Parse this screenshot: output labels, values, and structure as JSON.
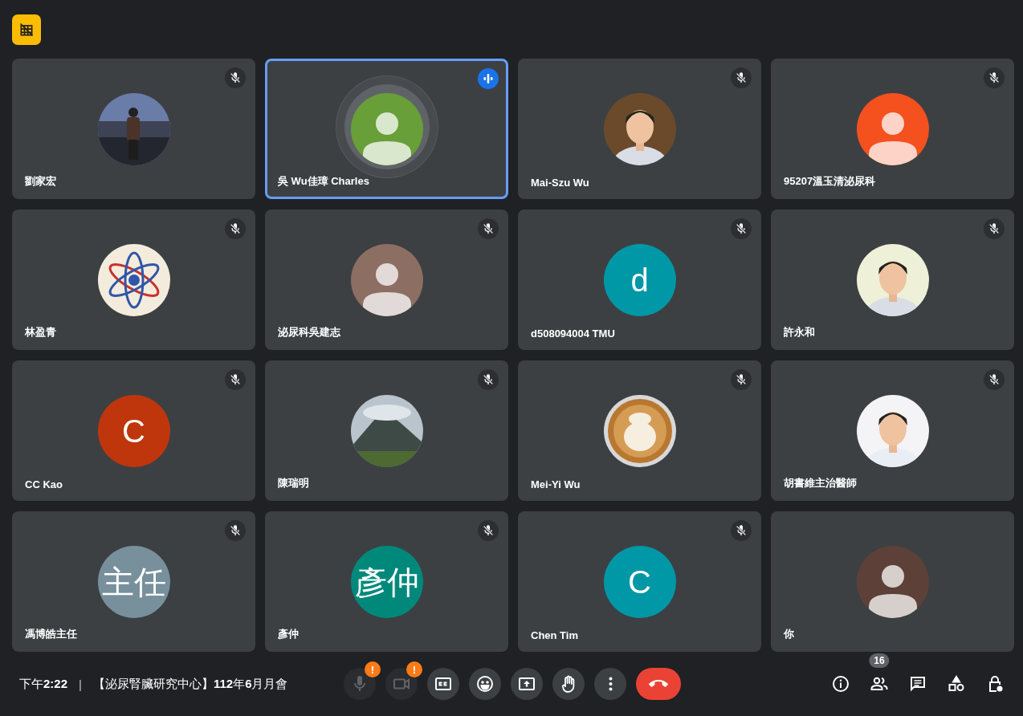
{
  "tiles": [
    {
      "name": "劉家宏",
      "muted": true,
      "speaking": false
    },
    {
      "name": "吳 Wu佳璋 Charles",
      "muted": false,
      "speaking": true,
      "avatar": {
        "kind": "default",
        "color": "#689f38"
      }
    },
    {
      "name": "Mai-Szu Wu",
      "muted": true,
      "speaking": false
    },
    {
      "name": "95207溫玉清泌尿科",
      "muted": true,
      "speaking": false,
      "avatar": {
        "kind": "default",
        "color": "#f4511e"
      }
    },
    {
      "name": "林盈青",
      "muted": true,
      "speaking": false
    },
    {
      "name": "泌尿科吳建志",
      "muted": true,
      "speaking": false,
      "avatar": {
        "kind": "default",
        "color": "#8d6e63"
      }
    },
    {
      "name": "d508094004 TMU",
      "muted": true,
      "speaking": false,
      "avatar": {
        "kind": "letter",
        "text": "d",
        "color": "#0097a7"
      }
    },
    {
      "name": "許永和",
      "muted": true,
      "speaking": false
    },
    {
      "name": "CC Kao",
      "muted": true,
      "speaking": false,
      "avatar": {
        "kind": "letter",
        "text": "C",
        "color": "#bf360c"
      }
    },
    {
      "name": "陳瑞明",
      "muted": true,
      "speaking": false
    },
    {
      "name": "Mei-Yi Wu",
      "muted": true,
      "speaking": false
    },
    {
      "name": "胡書維主治醫師",
      "muted": true,
      "speaking": false
    },
    {
      "name": "馮博皓主任",
      "muted": true,
      "speaking": false,
      "avatar": {
        "kind": "letter",
        "text": "主任",
        "color": "#78909c"
      }
    },
    {
      "name": "彥仲",
      "muted": true,
      "speaking": false,
      "avatar": {
        "kind": "letter",
        "text": "彥仲",
        "color": "#00897b"
      }
    },
    {
      "name": "Chen Tim",
      "muted": true,
      "speaking": false,
      "avatar": {
        "kind": "letter",
        "text": "C",
        "color": "#0097a7"
      }
    },
    {
      "name": "你",
      "muted": false,
      "speaking": false,
      "avatar": {
        "kind": "default",
        "color": "#5d4037"
      }
    }
  ],
  "bottom_bar": {
    "clock": "下午**2:22**",
    "separator": "|",
    "meeting_title": "【泌尿腎臟研究中心】**112**年**6**月月會",
    "controls": [
      {
        "kind": "mic",
        "disabled": true,
        "alert": "!"
      },
      {
        "kind": "camera",
        "disabled": true,
        "alert": "!"
      },
      {
        "kind": "captions",
        "disabled": false
      },
      {
        "kind": "reactions",
        "disabled": false
      },
      {
        "kind": "present",
        "disabled": false
      },
      {
        "kind": "hand",
        "disabled": false
      },
      {
        "kind": "more",
        "disabled": false
      },
      {
        "kind": "leave",
        "disabled": false
      }
    ],
    "tools": [
      {
        "kind": "info"
      },
      {
        "kind": "people",
        "badge": "16"
      },
      {
        "kind": "chat"
      },
      {
        "kind": "activities"
      },
      {
        "kind": "host"
      }
    ]
  }
}
